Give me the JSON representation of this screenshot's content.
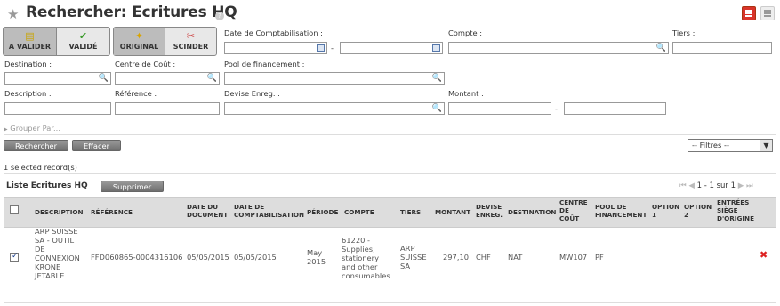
{
  "header": {
    "title": "Rechercher: Ecritures HQ",
    "help": "?"
  },
  "toggles": {
    "a_valider": "A VALIDER",
    "valide": "VALIDÉ",
    "original": "ORIGINAL",
    "scinder": "SCINDER"
  },
  "filters": {
    "date_compta": "Date de Comptabilisation :",
    "compte": "Compte :",
    "tiers": "Tiers :",
    "destination": "Destination :",
    "centre_cout": "Centre de Coût :",
    "pool_financement": "Pool de financement :",
    "description": "Description :",
    "reference": "Référence :",
    "devise": "Devise Enreg. :",
    "montant": "Montant :",
    "dash1": "-",
    "dash2": "-",
    "grouper": "Grouper Par..."
  },
  "actions": {
    "rechercher": "Rechercher",
    "effacer": "Effacer",
    "filtres": "-- Filtres --"
  },
  "status": {
    "selected": "1 selected record(s)"
  },
  "list": {
    "title": "Liste Ecritures HQ",
    "supprimer": "Supprimer",
    "pager": "1 - 1 sur 1",
    "columns": {
      "description": "DESCRIPTION",
      "reference": "RÉFÉRENCE",
      "date_doc_1": "DATE DU",
      "date_doc_2": "DOCUMENT",
      "date_compta_1": "DATE DE",
      "date_compta_2": "COMPTABILISATION",
      "periode": "PÉRIODE",
      "compte": "COMPTE",
      "tiers": "TIERS",
      "montant": "MONTANT",
      "devise_1": "DEVISE",
      "devise_2": "ENREG.",
      "destination": "DESTINATION",
      "centre_1": "CENTRE",
      "centre_2": "DE",
      "centre_3": "COÛT",
      "pool_1": "POOL DE",
      "pool_2": "FINANCEMENT",
      "option1_1": "OPTION",
      "option1_2": "1",
      "option2_1": "OPTION",
      "option2_2": "2",
      "entrees_1": "ENTRÉES",
      "entrees_2": "SIÈGE",
      "entrees_3": "D'ORIGINE"
    },
    "row": {
      "description": [
        "ARP SUISSE",
        "SA - OUTIL",
        "DE",
        "CONNEXION",
        "KRONE",
        "JETABLE"
      ],
      "reference": "FFD060865-0004316106",
      "date_doc": "05/05/2015",
      "date_compta": "05/05/2015",
      "periode": [
        "May",
        "2015"
      ],
      "compte": [
        "61220 -",
        "Supplies,",
        "stationery",
        "and other",
        "consumables"
      ],
      "tiers": [
        "ARP",
        "SUISSE",
        "SA"
      ],
      "montant": "297,10",
      "devise": "CHF",
      "destination": "NAT",
      "centre": "MW107",
      "pool": "PF"
    }
  }
}
